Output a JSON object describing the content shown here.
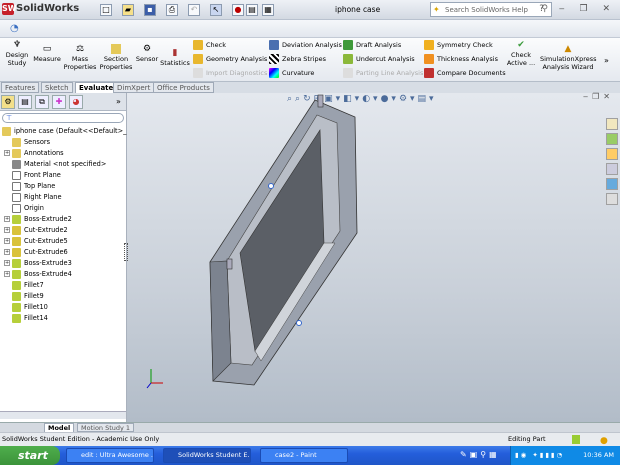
{
  "app": {
    "name": "SolidWorks",
    "document_title": "iphone case",
    "search_placeholder": "Search SolidWorks Help"
  },
  "ribbon": {
    "large": [
      {
        "label": "Design\nStudy",
        "icon": "design-study"
      },
      {
        "label": "Measure",
        "icon": "measure"
      },
      {
        "label": "Mass\nProperties",
        "icon": "mass-properties"
      },
      {
        "label": "Section\nProperties",
        "icon": "section-properties"
      },
      {
        "label": "Sensor",
        "icon": "sensor"
      },
      {
        "label": "Statistics",
        "icon": "statistics"
      }
    ],
    "col1": [
      {
        "label": "Check",
        "enabled": true
      },
      {
        "label": "Geometry Analysis",
        "enabled": true
      },
      {
        "label": "Import Diagnostics",
        "enabled": false
      }
    ],
    "col2": [
      {
        "label": "Deviation Analysis",
        "enabled": true
      },
      {
        "label": "Zebra Stripes",
        "enabled": true
      },
      {
        "label": "Curvature",
        "enabled": true
      }
    ],
    "col3": [
      {
        "label": "Draft Analysis",
        "enabled": true
      },
      {
        "label": "Undercut Analysis",
        "enabled": true
      },
      {
        "label": "Parting Line Analysis",
        "enabled": false
      }
    ],
    "col4": [
      {
        "label": "Symmetry Check",
        "enabled": true
      },
      {
        "label": "Thickness Analysis",
        "enabled": true
      },
      {
        "label": "Compare Documents",
        "enabled": true
      }
    ],
    "check_active": "Check\nActive ...",
    "simxpress": "SimulationXpress\nAnalysis Wizard"
  },
  "tabs": [
    "Features",
    "Sketch",
    "Evaluate",
    "DimXpert",
    "Office Products"
  ],
  "active_tab": "Evaluate",
  "tree": {
    "root": "iphone case  (Default<<Default>_Disp",
    "items": [
      {
        "label": "Sensors",
        "expandable": false,
        "icon": "sensor-folder"
      },
      {
        "label": "Annotations",
        "expandable": true,
        "icon": "annotations"
      },
      {
        "label": "Material <not specified>",
        "expandable": false,
        "icon": "material"
      },
      {
        "label": "Front Plane",
        "expandable": false,
        "icon": "plane"
      },
      {
        "label": "Top Plane",
        "expandable": false,
        "icon": "plane"
      },
      {
        "label": "Right Plane",
        "expandable": false,
        "icon": "plane"
      },
      {
        "label": "Origin",
        "expandable": false,
        "icon": "origin"
      },
      {
        "label": "Boss-Extrude2",
        "expandable": true,
        "icon": "boss-extrude"
      },
      {
        "label": "Cut-Extrude2",
        "expandable": true,
        "icon": "cut-extrude"
      },
      {
        "label": "Cut-Extrude5",
        "expandable": true,
        "icon": "cut-extrude"
      },
      {
        "label": "Cut-Extrude6",
        "expandable": true,
        "icon": "cut-extrude"
      },
      {
        "label": "Boss-Extrude3",
        "expandable": true,
        "icon": "boss-extrude"
      },
      {
        "label": "Boss-Extrude4",
        "expandable": true,
        "icon": "boss-extrude"
      },
      {
        "label": "Fillet7",
        "expandable": false,
        "icon": "fillet"
      },
      {
        "label": "Fillet9",
        "expandable": false,
        "icon": "fillet"
      },
      {
        "label": "Fillet10",
        "expandable": false,
        "icon": "fillet"
      },
      {
        "label": "Fillet14",
        "expandable": false,
        "icon": "fillet"
      }
    ]
  },
  "bottom_tabs": [
    "Model",
    "Motion Study 1"
  ],
  "status": {
    "left": "SolidWorks Student Edition - Academic Use Only",
    "right": "Editing Part"
  },
  "taskbar": {
    "start": "start",
    "tasks": [
      "edit : Ultra Awesome ...",
      "SolidWorks Student E...",
      "case2 - Paint"
    ],
    "active_task": 1,
    "clock": "10:36 AM"
  },
  "colors": {
    "model": "#8f96a3",
    "screen": "#5b5f66",
    "taskbar": "#245edb",
    "start": "#3b933a"
  }
}
